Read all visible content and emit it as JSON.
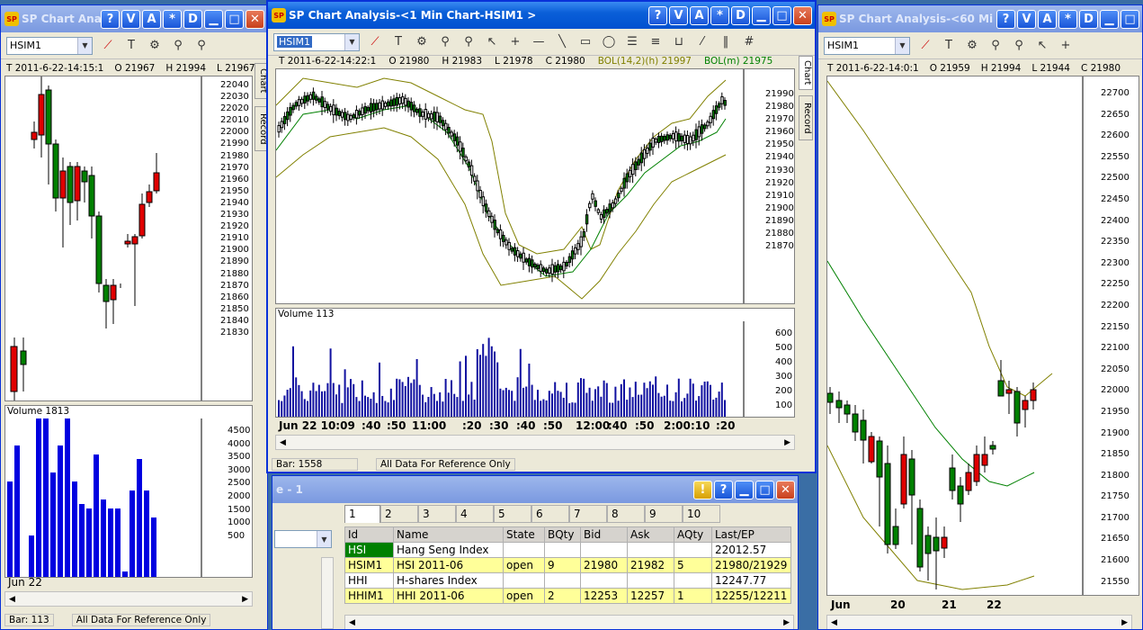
{
  "left": {
    "title": "SP Chart Analysis",
    "symbol": "HSIM1",
    "info": {
      "t": "T 2011-6-22-14:15:1",
      "o": "O 21967",
      "h": "H 21994",
      "l": "L 21967"
    },
    "price_ticks": [
      "22040",
      "22030",
      "22020",
      "22010",
      "22000",
      "21990",
      "21980",
      "21970",
      "21960",
      "21950",
      "21940",
      "21930",
      "21920",
      "21910",
      "21900",
      "21890",
      "21880",
      "21870",
      "21860",
      "21850",
      "21840",
      "21830"
    ],
    "vol_label": "Volume 1813",
    "vol_ticks": [
      "4500",
      "4000",
      "3500",
      "3000",
      "2500",
      "2000",
      "1500",
      "1000",
      "500"
    ],
    "x_label": "Jun 22",
    "status_bar": "Bar: 113",
    "status_note": "All Data For Reference Only"
  },
  "center": {
    "title": "SP Chart Analysis-<1 Min Chart-HSIM1 >",
    "symbol": "HSIM1",
    "info": {
      "t": "T 2011-6-22-14:22:1",
      "o": "O 21980",
      "h": "H 21983",
      "l": "L 21978",
      "c": "C 21980",
      "bol1": "BOL(14,2)(h) 21997",
      "bol2": "BOL(m) 21975"
    },
    "price_ticks": [
      "21990",
      "21980",
      "21970",
      "21960",
      "21950",
      "21940",
      "21930",
      "21920",
      "21910",
      "21900",
      "21890",
      "21880",
      "21870"
    ],
    "vol_label": "Volume 113",
    "vol_ticks": [
      "600",
      "500",
      "400",
      "300",
      "200",
      "100"
    ],
    "x_labels": [
      "Jun 22 10:09",
      ":40",
      ":50",
      "11:00",
      ":20",
      ":30",
      ":40",
      ":50",
      "12:00",
      ":40",
      ":50",
      "2:00",
      ":10",
      ":20"
    ],
    "tabs": [
      "Chart",
      "Record"
    ],
    "status_bar": "Bar: 1558",
    "status_note": "All Data For Reference Only"
  },
  "right": {
    "title": "SP Chart Analysis-<60 Mi",
    "symbol": "HSIM1",
    "info": {
      "t": "T 2011-6-22-14:0:1",
      "o": "O 21959",
      "h": "H 21994",
      "l": "L 21944",
      "c": "C 21980"
    },
    "price_ticks": [
      "22700",
      "22650",
      "22600",
      "22550",
      "22500",
      "22450",
      "22400",
      "22350",
      "22300",
      "22250",
      "22200",
      "22150",
      "22100",
      "22050",
      "22000",
      "21950",
      "21900",
      "21850",
      "21800",
      "21750",
      "21700",
      "21650",
      "21600",
      "21550"
    ],
    "x_labels": [
      "Jun",
      "20",
      "21",
      "22"
    ]
  },
  "quote": {
    "title": "e - 1",
    "tabs": [
      "1",
      "2",
      "3",
      "4",
      "5",
      "6",
      "7",
      "8",
      "9",
      "10"
    ],
    "columns": [
      "Id",
      "Name",
      "State",
      "BQty",
      "Bid",
      "Ask",
      "AQty",
      "Last/EP"
    ],
    "rows": [
      [
        "HSI",
        "Hang Seng Index",
        "",
        "",
        "",
        "",
        "",
        "22012.57"
      ],
      [
        "HSIM1",
        "HSI 2011-06",
        "open",
        "9",
        "21980",
        "21982",
        "5",
        "21980/21929"
      ],
      [
        "HHI",
        "H-shares Index",
        "",
        "",
        "",
        "",
        "",
        "12247.77"
      ],
      [
        "HHIM1",
        "HHI 2011-06",
        "open",
        "2",
        "12253",
        "12257",
        "1",
        "12255/12211"
      ]
    ]
  },
  "window_buttons": [
    "?",
    "V",
    "A",
    "*",
    "D"
  ],
  "colors": {
    "up": "#ffffff",
    "down": "#008000",
    "ma": "#008000",
    "band": "#808000",
    "volume": "#1010a0",
    "vol_left": "#0000e0",
    "red": "#e00000",
    "highlight": "#ffff99"
  }
}
